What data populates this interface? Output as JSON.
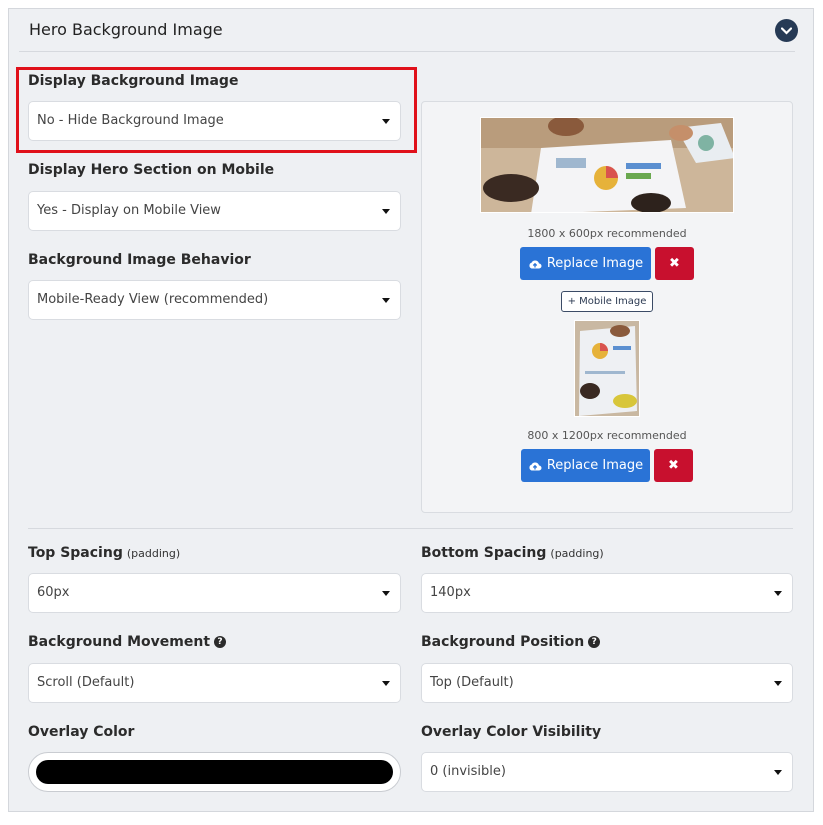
{
  "section": {
    "title": "Hero Background Image"
  },
  "display_bg": {
    "label": "Display Background Image",
    "value": "No - Hide Background Image"
  },
  "display_mobile": {
    "label": "Display Hero Section on Mobile",
    "value": "Yes - Display on Mobile View"
  },
  "bg_behavior": {
    "label": "Background Image Behavior",
    "value": "Mobile-Ready View (recommended)"
  },
  "desktop_image": {
    "recommendation": "1800 x 600px recommended",
    "replace_label": "Replace Image",
    "remove_label": "✖"
  },
  "add_mobile_label": "+ Mobile Image",
  "mobile_image": {
    "recommendation": "800 x 1200px recommended",
    "replace_label": "Replace Image",
    "remove_label": "✖"
  },
  "top_spacing": {
    "label": "Top Spacing",
    "sub": "(padding)",
    "value": "60px"
  },
  "bottom_spacing": {
    "label": "Bottom Spacing",
    "sub": "(padding)",
    "value": "140px"
  },
  "bg_movement": {
    "label": "Background Movement",
    "value": "Scroll (Default)"
  },
  "bg_position": {
    "label": "Background Position",
    "value": "Top (Default)"
  },
  "overlay_color": {
    "label": "Overlay Color",
    "color": "#000000"
  },
  "overlay_visibility": {
    "label": "Overlay Color Visibility",
    "value": "0 (invisible)"
  },
  "colors": {
    "primary_button": "#2a73d6",
    "danger_button": "#c8102e",
    "highlight": "#e0101a"
  }
}
